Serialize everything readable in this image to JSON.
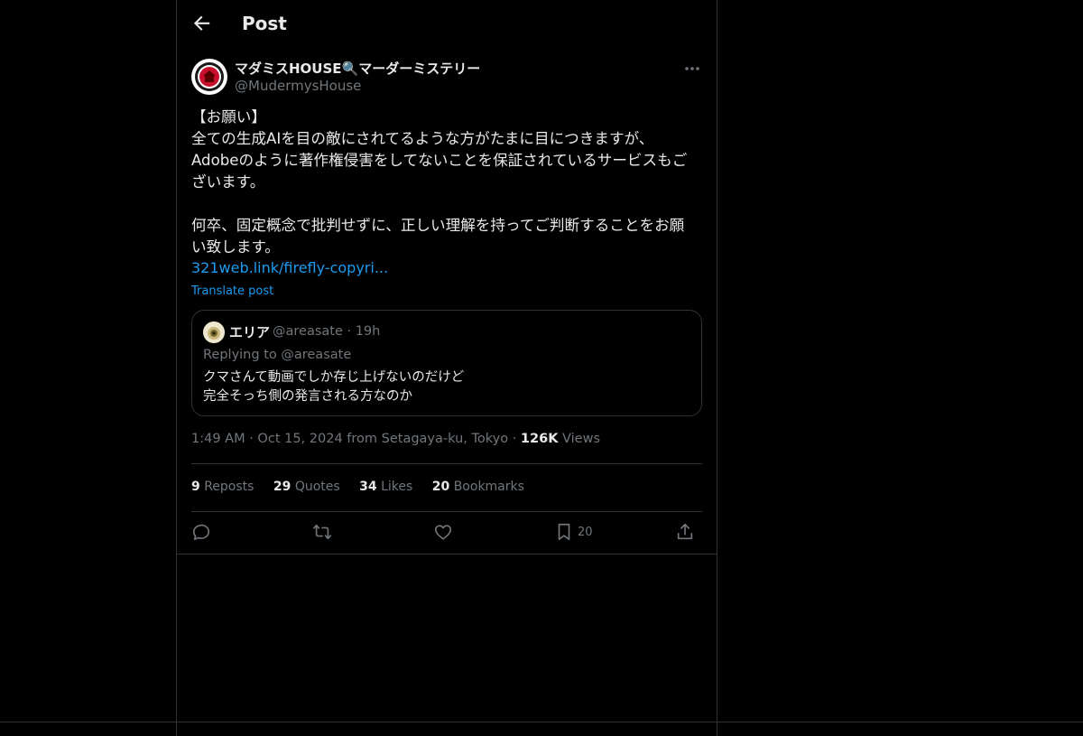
{
  "header": {
    "title": "Post"
  },
  "author": {
    "display_name": "マダミスHOUSE🔍マーダーミステリー",
    "handle": "@MudermysHouse"
  },
  "post": {
    "text": "【お願い】\n全ての生成AIを目の敵にされてるような方がたまに目につきますが、\nAdobeのように著作権侵害をしてないことを保証されているサービスもご\nざいます。\n\n何卒、固定概念で批判せずに、正しい理解を持ってご判断することをお願\nい致します。",
    "link": "321web.link/firefly-copyri...",
    "translate_label": "Translate post"
  },
  "quote": {
    "display_name": "エリア",
    "meta": "@areasate · 19h",
    "replying_to": "Replying to @areasate",
    "text": "クマさんて動画でしか存じ上げないのだけど\n完全そっち側の発言される方なのか"
  },
  "timestamp": {
    "text": "1:49 AM · Oct 15, 2024 from Setagaya-ku, Tokyo · ",
    "views_count": "126K",
    "views_label": " Views"
  },
  "stats": [
    {
      "count": "9",
      "label": "Reposts"
    },
    {
      "count": "29",
      "label": "Quotes"
    },
    {
      "count": "34",
      "label": "Likes"
    },
    {
      "count": "20",
      "label": "Bookmarks"
    }
  ],
  "actions": {
    "bookmark_count": "20",
    "icons": [
      "reply-icon",
      "repost-icon",
      "like-icon",
      "bookmark-icon",
      "share-icon"
    ]
  },
  "colors": {
    "background": "#000000",
    "text": "#e7e9ea",
    "secondary": "#71767b",
    "accent": "#1d9bf0",
    "border": "#2f3336"
  }
}
